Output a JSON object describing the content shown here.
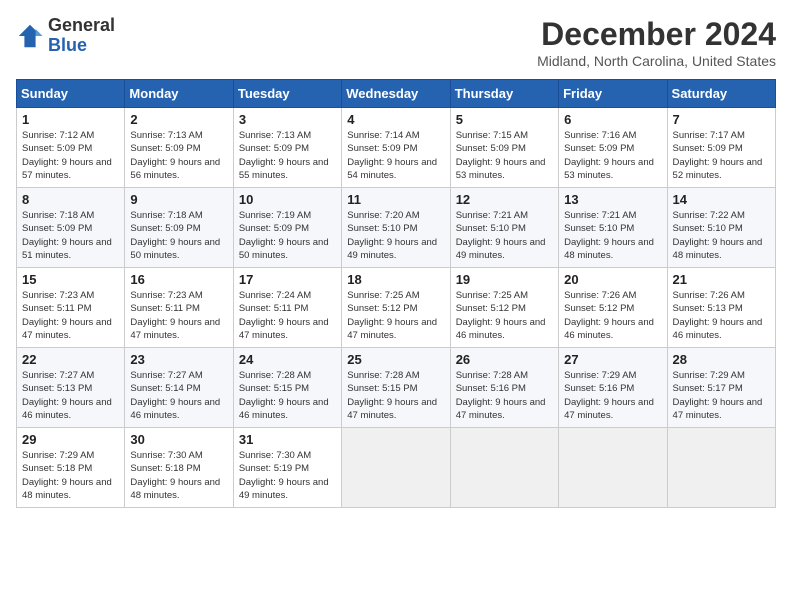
{
  "logo": {
    "line1": "General",
    "line2": "Blue"
  },
  "title": "December 2024",
  "location": "Midland, North Carolina, United States",
  "days_header": [
    "Sunday",
    "Monday",
    "Tuesday",
    "Wednesday",
    "Thursday",
    "Friday",
    "Saturday"
  ],
  "weeks": [
    [
      {
        "day": "1",
        "sunrise": "7:12 AM",
        "sunset": "5:09 PM",
        "daylight": "9 hours and 57 minutes."
      },
      {
        "day": "2",
        "sunrise": "7:13 AM",
        "sunset": "5:09 PM",
        "daylight": "9 hours and 56 minutes."
      },
      {
        "day": "3",
        "sunrise": "7:13 AM",
        "sunset": "5:09 PM",
        "daylight": "9 hours and 55 minutes."
      },
      {
        "day": "4",
        "sunrise": "7:14 AM",
        "sunset": "5:09 PM",
        "daylight": "9 hours and 54 minutes."
      },
      {
        "day": "5",
        "sunrise": "7:15 AM",
        "sunset": "5:09 PM",
        "daylight": "9 hours and 53 minutes."
      },
      {
        "day": "6",
        "sunrise": "7:16 AM",
        "sunset": "5:09 PM",
        "daylight": "9 hours and 53 minutes."
      },
      {
        "day": "7",
        "sunrise": "7:17 AM",
        "sunset": "5:09 PM",
        "daylight": "9 hours and 52 minutes."
      }
    ],
    [
      {
        "day": "8",
        "sunrise": "7:18 AM",
        "sunset": "5:09 PM",
        "daylight": "9 hours and 51 minutes."
      },
      {
        "day": "9",
        "sunrise": "7:18 AM",
        "sunset": "5:09 PM",
        "daylight": "9 hours and 50 minutes."
      },
      {
        "day": "10",
        "sunrise": "7:19 AM",
        "sunset": "5:09 PM",
        "daylight": "9 hours and 50 minutes."
      },
      {
        "day": "11",
        "sunrise": "7:20 AM",
        "sunset": "5:10 PM",
        "daylight": "9 hours and 49 minutes."
      },
      {
        "day": "12",
        "sunrise": "7:21 AM",
        "sunset": "5:10 PM",
        "daylight": "9 hours and 49 minutes."
      },
      {
        "day": "13",
        "sunrise": "7:21 AM",
        "sunset": "5:10 PM",
        "daylight": "9 hours and 48 minutes."
      },
      {
        "day": "14",
        "sunrise": "7:22 AM",
        "sunset": "5:10 PM",
        "daylight": "9 hours and 48 minutes."
      }
    ],
    [
      {
        "day": "15",
        "sunrise": "7:23 AM",
        "sunset": "5:11 PM",
        "daylight": "9 hours and 47 minutes."
      },
      {
        "day": "16",
        "sunrise": "7:23 AM",
        "sunset": "5:11 PM",
        "daylight": "9 hours and 47 minutes."
      },
      {
        "day": "17",
        "sunrise": "7:24 AM",
        "sunset": "5:11 PM",
        "daylight": "9 hours and 47 minutes."
      },
      {
        "day": "18",
        "sunrise": "7:25 AM",
        "sunset": "5:12 PM",
        "daylight": "9 hours and 47 minutes."
      },
      {
        "day": "19",
        "sunrise": "7:25 AM",
        "sunset": "5:12 PM",
        "daylight": "9 hours and 46 minutes."
      },
      {
        "day": "20",
        "sunrise": "7:26 AM",
        "sunset": "5:12 PM",
        "daylight": "9 hours and 46 minutes."
      },
      {
        "day": "21",
        "sunrise": "7:26 AM",
        "sunset": "5:13 PM",
        "daylight": "9 hours and 46 minutes."
      }
    ],
    [
      {
        "day": "22",
        "sunrise": "7:27 AM",
        "sunset": "5:13 PM",
        "daylight": "9 hours and 46 minutes."
      },
      {
        "day": "23",
        "sunrise": "7:27 AM",
        "sunset": "5:14 PM",
        "daylight": "9 hours and 46 minutes."
      },
      {
        "day": "24",
        "sunrise": "7:28 AM",
        "sunset": "5:15 PM",
        "daylight": "9 hours and 46 minutes."
      },
      {
        "day": "25",
        "sunrise": "7:28 AM",
        "sunset": "5:15 PM",
        "daylight": "9 hours and 47 minutes."
      },
      {
        "day": "26",
        "sunrise": "7:28 AM",
        "sunset": "5:16 PM",
        "daylight": "9 hours and 47 minutes."
      },
      {
        "day": "27",
        "sunrise": "7:29 AM",
        "sunset": "5:16 PM",
        "daylight": "9 hours and 47 minutes."
      },
      {
        "day": "28",
        "sunrise": "7:29 AM",
        "sunset": "5:17 PM",
        "daylight": "9 hours and 47 minutes."
      }
    ],
    [
      {
        "day": "29",
        "sunrise": "7:29 AM",
        "sunset": "5:18 PM",
        "daylight": "9 hours and 48 minutes."
      },
      {
        "day": "30",
        "sunrise": "7:30 AM",
        "sunset": "5:18 PM",
        "daylight": "9 hours and 48 minutes."
      },
      {
        "day": "31",
        "sunrise": "7:30 AM",
        "sunset": "5:19 PM",
        "daylight": "9 hours and 49 minutes."
      },
      null,
      null,
      null,
      null
    ]
  ]
}
